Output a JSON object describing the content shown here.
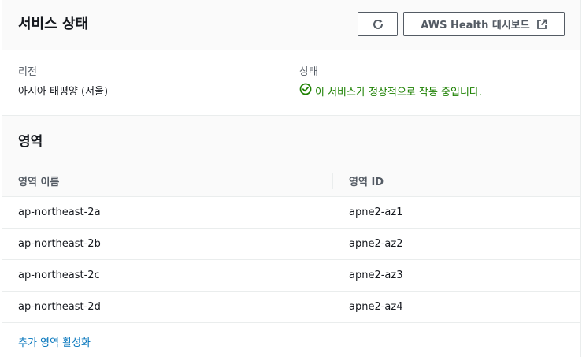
{
  "service_status": {
    "title": "서비스 상태",
    "refresh_icon": "refresh-icon",
    "health_button_label": "AWS Health 대시보드",
    "external_icon": "external-link-icon"
  },
  "info": {
    "region_label": "리전",
    "region_value": "아시아 태평양 (서울)",
    "status_label": "상태",
    "status_value": "이 서비스가 정상적으로 작동 중입니다.",
    "status_color": "#1d8102"
  },
  "zones": {
    "title": "영역",
    "columns": [
      "영역 이름",
      "영역 ID"
    ],
    "rows": [
      {
        "name": "ap-northeast-2a",
        "id": "apne2-az1"
      },
      {
        "name": "ap-northeast-2b",
        "id": "apne2-az2"
      },
      {
        "name": "ap-northeast-2c",
        "id": "apne2-az3"
      },
      {
        "name": "ap-northeast-2d",
        "id": "apne2-az4"
      }
    ],
    "enable_link": "추가 영역 활성화"
  }
}
